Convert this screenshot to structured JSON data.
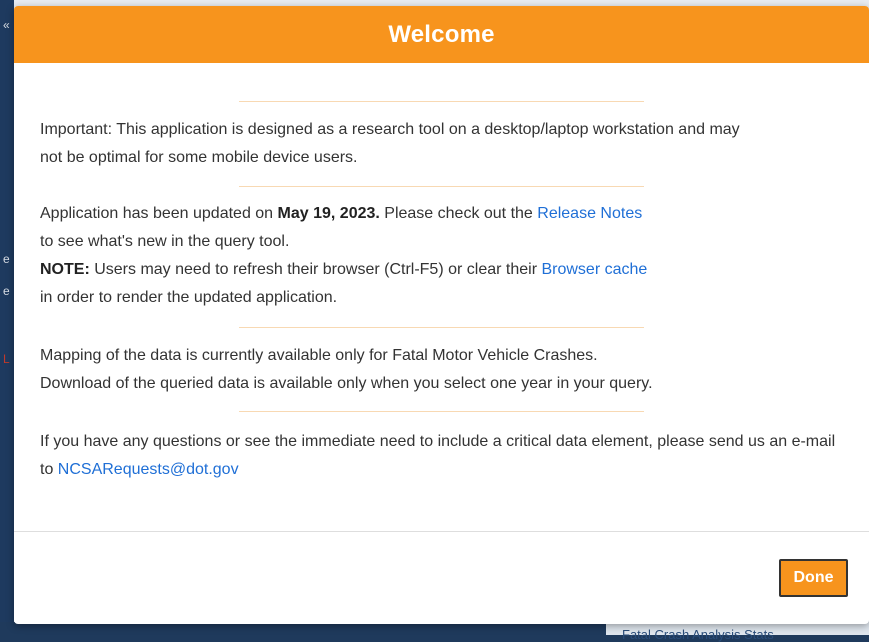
{
  "background": {
    "bottom_right_text": "Fatal Crash Analysis Stats",
    "edge_glyphs": [
      "«",
      "e",
      "e",
      "L"
    ]
  },
  "modal": {
    "title": "Welcome",
    "section1": {
      "text": "Important: This application is designed as a research tool on a desktop/laptop workstation and may not be optimal for some mobile device users."
    },
    "section2": {
      "line1_prefix": "Application has been updated on ",
      "date": "May 19, 2023.",
      "line1_middle": " Please check out the ",
      "release_notes_link": "Release Notes",
      "line2": " to see what's new in the query tool.",
      "note_label": "NOTE:",
      "note_text": " Users may need to refresh their browser (Ctrl-F5) or clear their ",
      "browser_cache_link": "Browser cache",
      "note_tail": " in order to render the updated application."
    },
    "section3": {
      "line1": "Mapping of the data is currently available only for Fatal Motor Vehicle Crashes.",
      "line2": "Download of the queried data is available only when you select one year in your query."
    },
    "section4": {
      "text": "If you have any questions or see the immediate need to include a critical data element, please send us an e-mail to ",
      "email_link": "NCSARequests@dot.gov"
    },
    "done_label": "Done"
  },
  "colors": {
    "header": "#f7941d",
    "link": "#1f6fd6",
    "divider": "#f8d9b3",
    "backdrop": "#1f3a5c"
  }
}
